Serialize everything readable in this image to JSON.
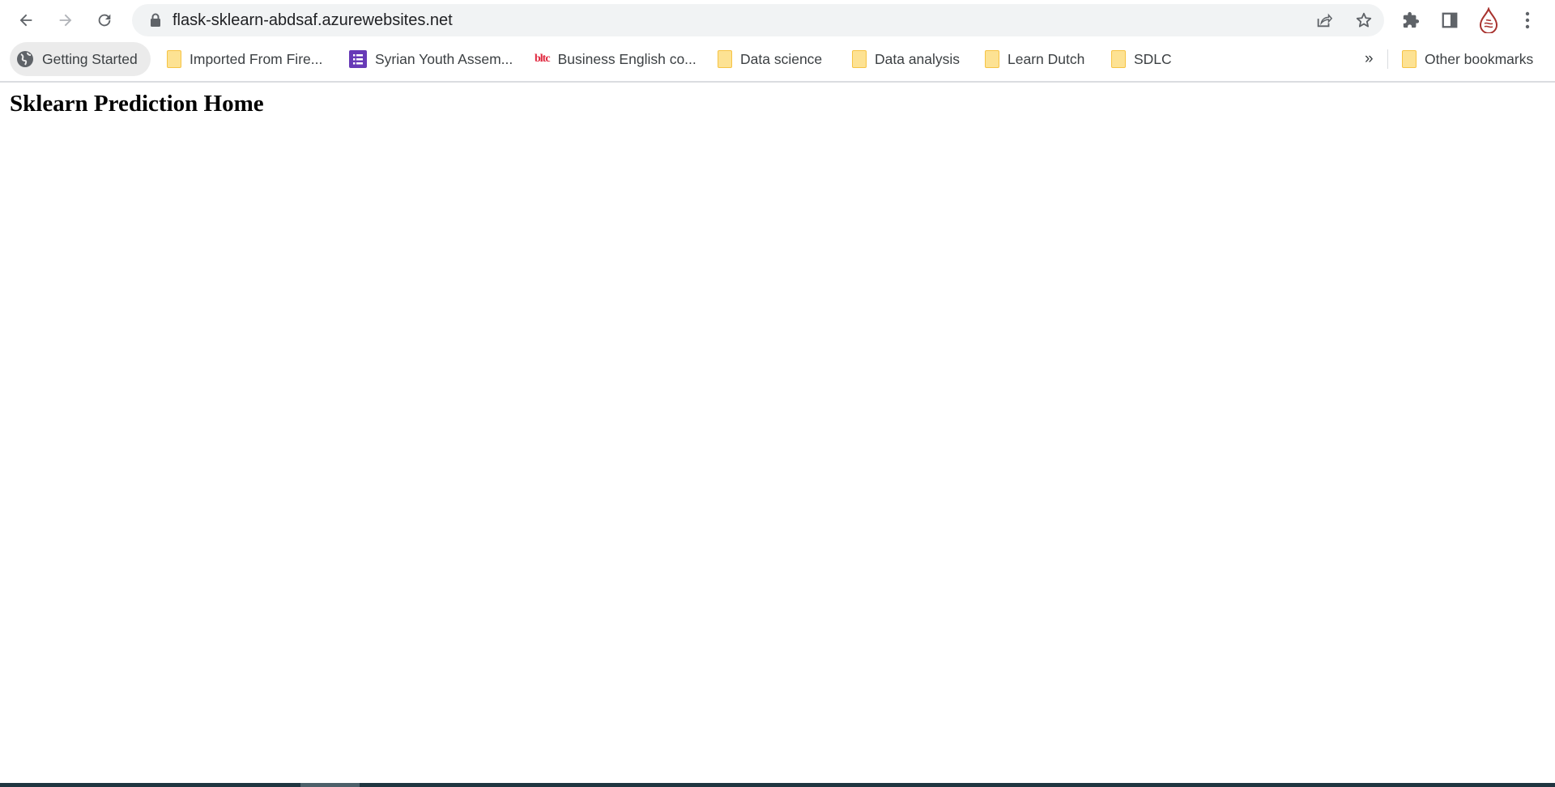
{
  "browser": {
    "url": "flask-sklearn-abdsaf.azurewebsites.net",
    "icons": [
      "back-arrow",
      "forward-arrow",
      "reload",
      "lock",
      "share",
      "star",
      "puzzle-extensions",
      "side-panel",
      "profile-avatar",
      "kebab-menu"
    ],
    "bookmarks": [
      {
        "label": "Getting Started",
        "icon": "globe-icon"
      },
      {
        "label": "Imported From Fire...",
        "icon": "folder-icon"
      },
      {
        "label": "Syrian Youth Assem...",
        "icon": "google-forms-icon"
      },
      {
        "label": "Business English co...",
        "icon": "bltc-icon"
      },
      {
        "label": "Data science",
        "icon": "folder-icon"
      },
      {
        "label": "Data analysis",
        "icon": "folder-icon"
      },
      {
        "label": "Learn Dutch",
        "icon": "folder-icon"
      },
      {
        "label": "SDLC",
        "icon": "folder-icon"
      }
    ],
    "overflow_label": "»",
    "other_bookmarks": "Other bookmarks",
    "bltc_logo": "bltc"
  },
  "page": {
    "heading": "Sklearn Prediction Home"
  },
  "colors": {
    "omnibox_bg": "#f1f3f4",
    "folder": "#fde293",
    "forms_purple": "#673ab7",
    "taskbar": "#1f3540"
  }
}
